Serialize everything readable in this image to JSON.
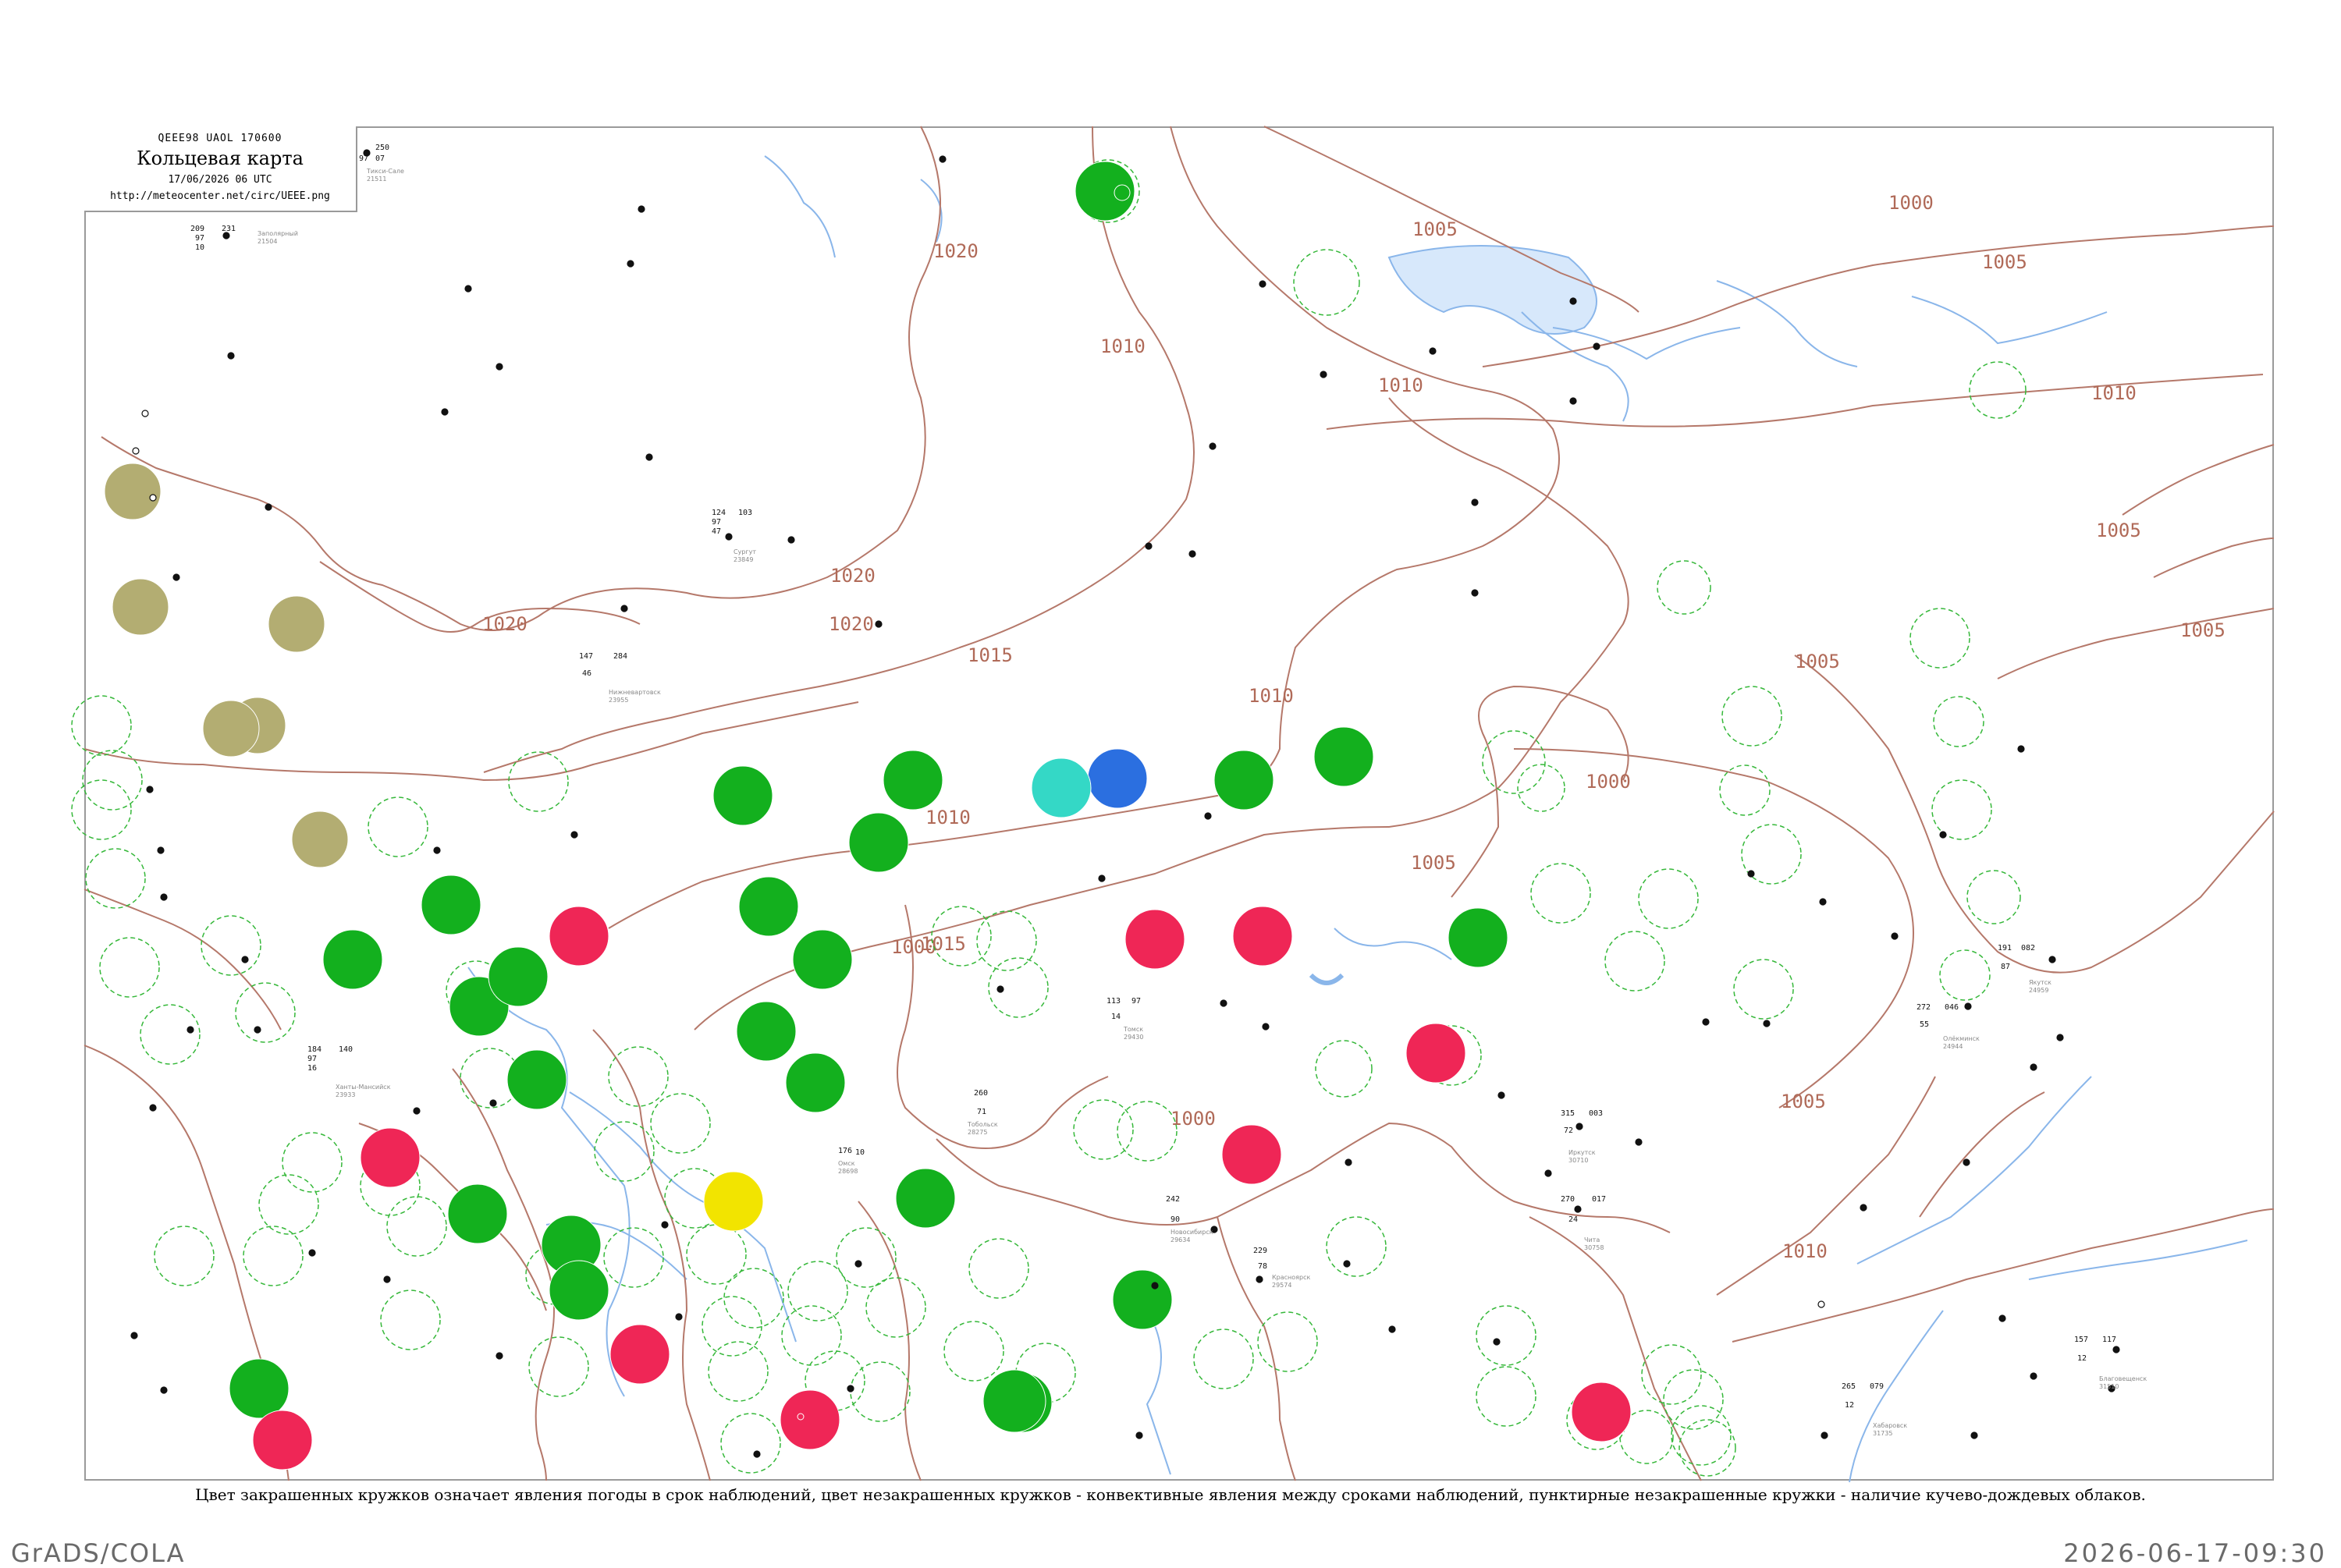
{
  "header": {
    "code_line": "QEEE98  UAOL  170600",
    "title": "Кольцевая карта",
    "datetime": "17/06/2026 06 UTC",
    "url": "http://meteocenter.net/circ/UEEE.png"
  },
  "caption": "Цвет закрашенных кружков означает явления погоды в срок наблюдений, цвет незакрашенных кружков - конвективные явления между сроками наблюдений, пунктирные незакрашенные кружки - наличие кучево-дождевых облаков.",
  "footer": {
    "left": "GrADS/COLA",
    "right": "2026-06-17-09:30"
  },
  "colors": {
    "green": "#13b01e",
    "red": "#ef2656",
    "olive": "#b3ad72",
    "blue": "#2b6fe0",
    "cyan": "#34d8c6",
    "yellow": "#f2e400",
    "dashed_ring": "#36b83a",
    "isobar": "#b5786a",
    "water": "#8ab6ea"
  },
  "isobar_labels": [
    "1020",
    "1015",
    "1010",
    "1005",
    "1000",
    "1020",
    "1020",
    "1015",
    "1010",
    "1005",
    "1000",
    "1005",
    "1010",
    "1010",
    "1005",
    "1005",
    "1000",
    "1005",
    "1010",
    "1000",
    "1005",
    "1010",
    "1020"
  ],
  "featured_stations": [
    {
      "name": "Тикси-Сале",
      "id": "21511",
      "obs": [
        "250",
        "97",
        "07"
      ]
    },
    {
      "name": "Заполярный",
      "id": "21504",
      "obs": [
        "209",
        "231",
        "97",
        "10"
      ]
    },
    {
      "name": "Ханты-Мансийск",
      "id": "23933",
      "obs": [
        "184",
        "140",
        "97",
        "16"
      ]
    },
    {
      "name": "Сургут",
      "id": "23849",
      "obs": [
        "124",
        "103",
        "97",
        "47"
      ]
    },
    {
      "name": "Нижневартовск",
      "id": "23955",
      "obs": [
        "147",
        "284",
        "46"
      ]
    },
    {
      "name": "Тобольск",
      "id": "28275",
      "obs": [
        "260",
        "71"
      ]
    },
    {
      "name": "Омск",
      "id": "28698",
      "obs": [
        "176",
        "10"
      ]
    },
    {
      "name": "Томск",
      "id": "29430",
      "obs": [
        "113",
        "97",
        "14"
      ]
    },
    {
      "name": "Новосибирск",
      "id": "29634",
      "obs": [
        "242",
        "90"
      ]
    },
    {
      "name": "Красноярск",
      "id": "29574",
      "obs": [
        "229",
        "78"
      ]
    },
    {
      "name": "Иркутск",
      "id": "30710",
      "obs": [
        "315",
        "003",
        "72"
      ]
    },
    {
      "name": "Чита",
      "id": "30758",
      "obs": [
        "270",
        "017",
        "24"
      ]
    },
    {
      "name": "Якутск",
      "id": "24959",
      "obs": [
        "191",
        "082",
        "87"
      ]
    },
    {
      "name": "Олёкминск",
      "id": "24944",
      "obs": [
        "272",
        "046",
        "55"
      ]
    },
    {
      "name": "Благовещенск",
      "id": "31510",
      "obs": [
        "157",
        "117",
        "12"
      ]
    },
    {
      "name": "Хабаровск",
      "id": "31735",
      "obs": [
        "265",
        "079",
        "12"
      ]
    }
  ]
}
